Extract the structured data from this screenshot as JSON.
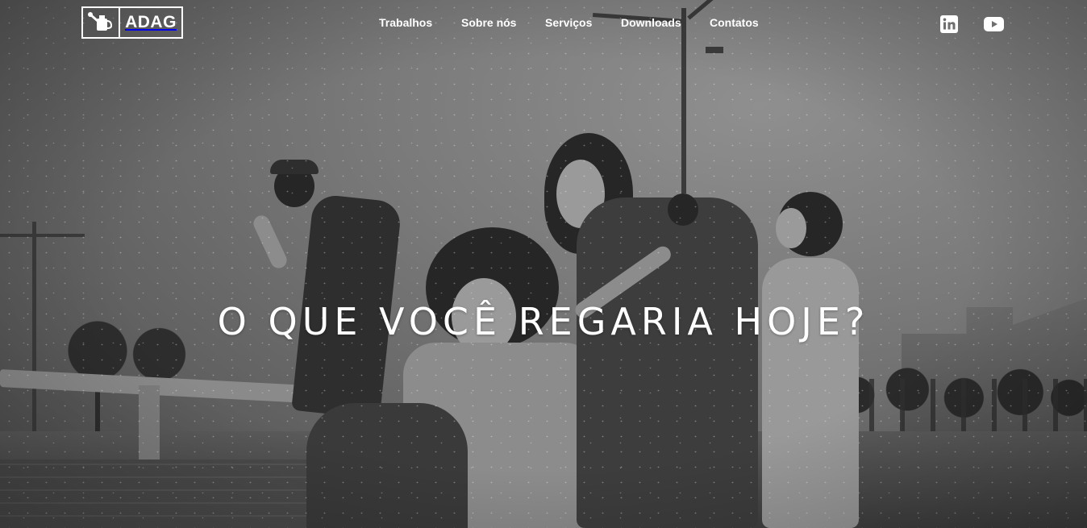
{
  "brand": {
    "logo_text": "ADAG",
    "logo_icon": "watering-can-icon"
  },
  "nav": {
    "items": [
      {
        "label": "Trabalhos"
      },
      {
        "label": "Sobre nós"
      },
      {
        "label": "Serviços"
      },
      {
        "label": "Downloads"
      },
      {
        "label": "Contatos"
      }
    ]
  },
  "social": {
    "linkedin_icon": "linkedin-icon",
    "youtube_icon": "youtube-icon"
  },
  "hero": {
    "headline": "O QUE VOCÊ REGARIA HOJE?",
    "image_description_icon": "group-of-friends-photo"
  },
  "colors": {
    "nav_text": "#ffffff",
    "headline_text": "#ffffff"
  }
}
